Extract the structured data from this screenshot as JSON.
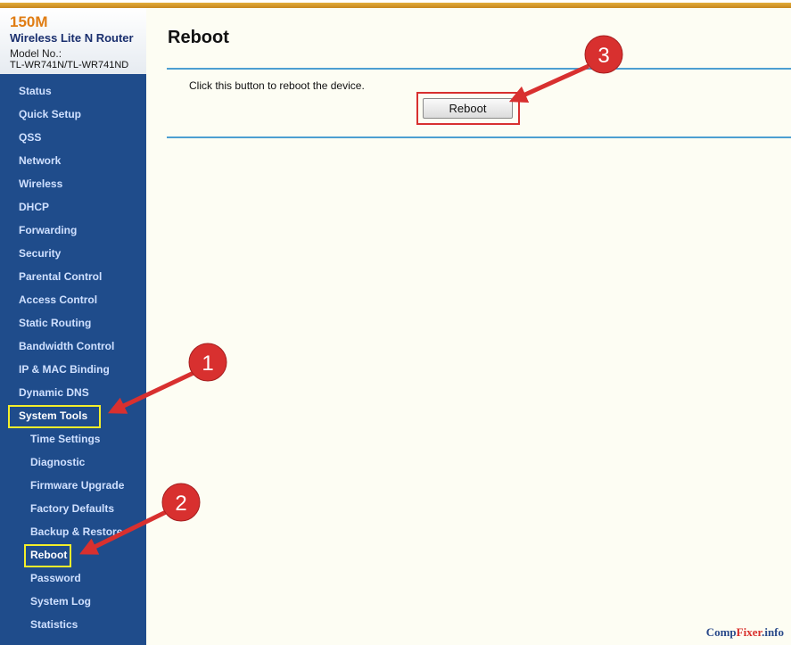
{
  "brand": {
    "speed": "150M",
    "product": "Wireless Lite N Router",
    "model_label": "Model No.:",
    "model_value": "TL-WR741N/TL-WR741ND"
  },
  "menu": [
    {
      "label": "Status"
    },
    {
      "label": "Quick Setup"
    },
    {
      "label": "QSS"
    },
    {
      "label": "Network"
    },
    {
      "label": "Wireless"
    },
    {
      "label": "DHCP"
    },
    {
      "label": "Forwarding"
    },
    {
      "label": "Security"
    },
    {
      "label": "Parental Control"
    },
    {
      "label": "Access Control"
    },
    {
      "label": "Static Routing"
    },
    {
      "label": "Bandwidth Control"
    },
    {
      "label": "IP & MAC Binding"
    },
    {
      "label": "Dynamic DNS"
    },
    {
      "label": "System Tools"
    }
  ],
  "submenu": [
    {
      "label": "Time Settings"
    },
    {
      "label": "Diagnostic"
    },
    {
      "label": "Firmware Upgrade"
    },
    {
      "label": "Factory Defaults"
    },
    {
      "label": "Backup & Restore"
    },
    {
      "label": "Reboot"
    },
    {
      "label": "Password"
    },
    {
      "label": "System Log"
    },
    {
      "label": "Statistics"
    }
  ],
  "page": {
    "title": "Reboot",
    "hint": "Click this button to reboot the device.",
    "button_label": "Reboot"
  },
  "annotations": {
    "step1": "1",
    "step2": "2",
    "step3": "3",
    "color": "#d8302f"
  },
  "watermark": {
    "part1": "Comp",
    "part2": "Fixer",
    "part3": ".info"
  }
}
